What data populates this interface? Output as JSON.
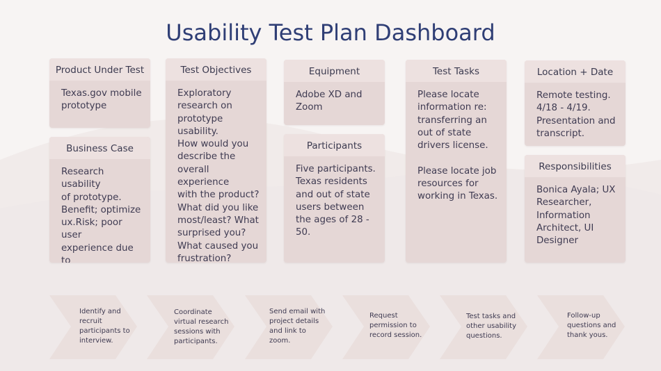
{
  "title": "Usability Test Plan Dashboard",
  "cards": [
    {
      "id": "product",
      "header": "Product Under Test",
      "body": "Texas.gov mobile\nprototype"
    },
    {
      "id": "business",
      "header": "Business Case",
      "body": "Research usability\nof prototype.\nBenefit; optimize\nux.Risk; poor user\nexperience due to\ndesigner implicit\nbias."
    },
    {
      "id": "objectives",
      "header": "Test Objectives",
      "body": "Exploratory\nresearch on\nprototype\nusability.\nHow would you\ndescribe the\noverall experience\nwith the product?\nWhat did you like\nmost/least? What\nsurprised you?\nWhat caused you\nfrustration?"
    },
    {
      "id": "equipment",
      "header": "Equipment",
      "body": "Adobe XD and\nZoom"
    },
    {
      "id": "participants",
      "header": "Participants",
      "body": "Five participants.\nTexas residents\nand out of state\nusers between\nthe ages of 28 -\n50."
    },
    {
      "id": "tasks",
      "header": "Test Tasks",
      "body": "Please locate\ninformation re:\ntransferring an\nout of state\ndrivers license.\n\nPlease locate job\nresources for\nworking in Texas."
    },
    {
      "id": "location",
      "header": "Location + Date",
      "body": "Remote testing.\n4/18 - 4/19.\nPresentation and\ntranscript."
    },
    {
      "id": "responsibilities",
      "header": "Responsibilities",
      "body": "Bonica Ayala; UX\nResearcher,\nInformation\nArchitect, UI\nDesigner"
    }
  ],
  "steps": [
    "Identify and\nrecruit\nparticipants to\ninterview.",
    "Coordinate\nvirtual research\nsessions with\nparticipants.",
    "Send email with\nproject details\nand link to\nzoom.",
    "Request\npermission to\nrecord session.",
    "Test tasks and\nother usability\nquestions.",
    "Follow-up\nquestions and\nthank yous."
  ],
  "colors": {
    "background": "#f7f4f3",
    "card": "#e5d7d6",
    "card_header": "#ede1e0",
    "chevron": "#eadfdd",
    "title": "#2f3e75",
    "text": "#3f3b52"
  }
}
